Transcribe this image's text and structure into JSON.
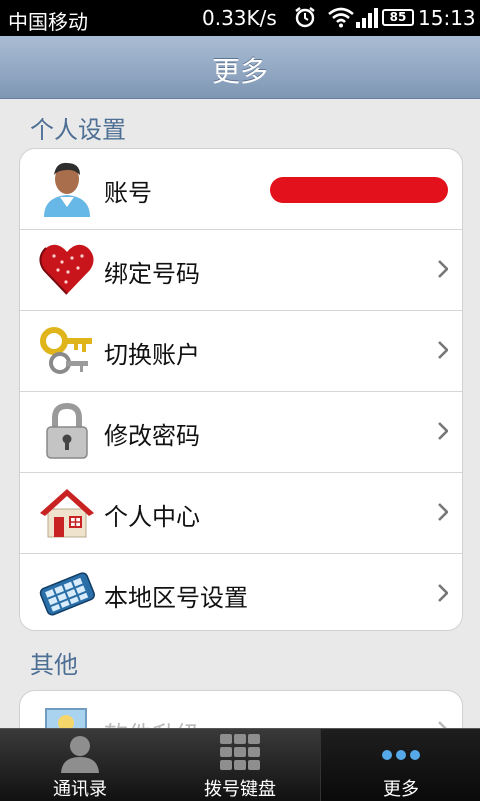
{
  "status_bar": {
    "carrier": "中国移动",
    "network_speed": "0.33K/s",
    "battery": "85",
    "time": "15:13"
  },
  "title": "更多",
  "sections": [
    {
      "header": "个人设置",
      "items": [
        {
          "label": "账号",
          "icon": "user-avatar-icon"
        },
        {
          "label": "绑定号码",
          "icon": "heart-icon"
        },
        {
          "label": "切换账户",
          "icon": "keys-icon"
        },
        {
          "label": "修改密码",
          "icon": "padlock-icon"
        },
        {
          "label": "个人中心",
          "icon": "house-icon"
        },
        {
          "label": "本地区号设置",
          "icon": "keypad-phone-icon"
        }
      ]
    },
    {
      "header": "其他",
      "items": [
        {
          "label": "软件升级",
          "icon": "upgrade-icon"
        }
      ]
    }
  ],
  "bottom_nav": {
    "contacts": "通讯录",
    "dialpad": "拨号键盘",
    "more": "更多"
  },
  "colors": {
    "title_bar": "#8ea4bf",
    "section_header": "#4d6f94",
    "redaction": "#e3111b"
  }
}
